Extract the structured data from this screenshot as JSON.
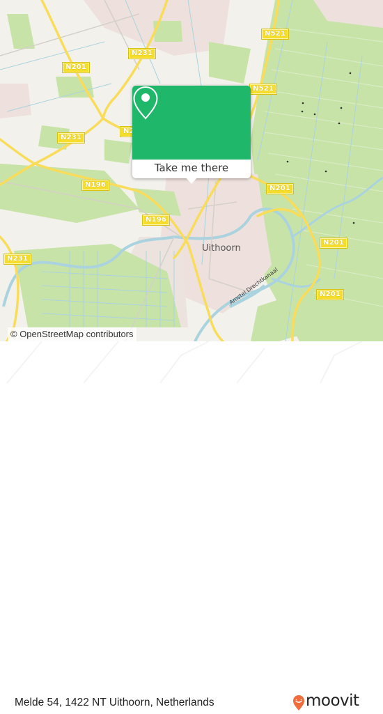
{
  "map": {
    "road_labels": [
      {
        "id": "n521-top",
        "text": "N521"
      },
      {
        "id": "n231-top",
        "text": "N231"
      },
      {
        "id": "n201-left",
        "text": "N201"
      },
      {
        "id": "n521-mid",
        "text": "N521"
      },
      {
        "id": "n231-left",
        "text": "N231"
      },
      {
        "id": "n2-partial",
        "text": "N2"
      },
      {
        "id": "n196-left",
        "text": "N196"
      },
      {
        "id": "n201-right",
        "text": "N201"
      },
      {
        "id": "n196-mid",
        "text": "N196"
      },
      {
        "id": "n201-east",
        "text": "N201"
      },
      {
        "id": "n231-sw",
        "text": "N231"
      },
      {
        "id": "n201-se",
        "text": "N201"
      }
    ],
    "place_label": "Uithoorn",
    "canal_label": "Amstel Drechtkanaal",
    "attribution": "© OpenStreetMap contributors",
    "colors": {
      "water": "#aad3df",
      "green": "#c8e3a8",
      "built": "#eee0dc",
      "road": "#f6dd2c"
    }
  },
  "popup": {
    "button_label": "Take me there",
    "icon": "location-pin-icon",
    "color": "#1fb86a"
  },
  "footer": {
    "address": "Melde 54, 1422 NT Uithoorn, Netherlands",
    "brand": "moovit",
    "brand_color": "#f26b3a"
  }
}
